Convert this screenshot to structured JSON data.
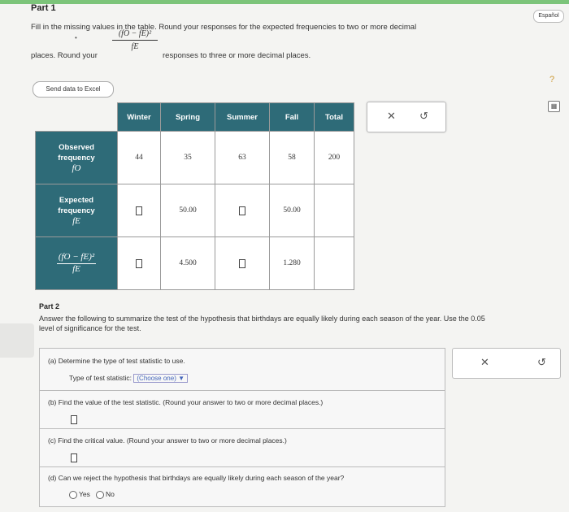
{
  "part1": {
    "heading": "Part 1",
    "instruction_line1": "Fill in the missing values in the table. Round your responses for the expected frequencies to two or more decimal",
    "instruction_line2_a": "places. Round your",
    "instruction_line2_b": "responses to three or more decimal places.",
    "fraction_num": "(fO − fE)²",
    "fraction_den": "fE",
    "excel_button": "Send data to Excel"
  },
  "header": {
    "espanol": "Español",
    "help": "?",
    "calculator": "▦"
  },
  "table": {
    "columns": [
      "Winter",
      "Spring",
      "Summer",
      "Fall",
      "Total"
    ],
    "rows": [
      {
        "label_line1": "Observed",
        "label_line2": "frequency",
        "symbol": "fO",
        "cells": [
          "44",
          "35",
          "63",
          "58",
          "200"
        ]
      },
      {
        "label_line1": "Expected",
        "label_line2": "frequency",
        "symbol": "fE",
        "cells": [
          "",
          "50.00",
          "",
          "50.00",
          ""
        ]
      },
      {
        "label_num": "(fO − fE)²",
        "label_den": "fE",
        "cells": [
          "",
          "4.500",
          "",
          "1.280",
          ""
        ]
      }
    ]
  },
  "widget": {
    "clear": "✕",
    "undo": "↺"
  },
  "part2": {
    "heading": "Part 2",
    "text": "Answer the following to summarize the test of the hypothesis that birthdays are equally likely during each season of the year. Use the 0.05 level of significance for the test.",
    "qa_label": "(a)  Determine the type of test statistic to use.",
    "qa_sub": "Type of test statistic:",
    "qa_select": "(Choose one) ▼",
    "qb_label": "(b)  Find the value of the test statistic. (Round your answer to two or more decimal places.)",
    "qc_label": "(c)  Find the critical value. (Round your answer to two or more decimal places.)",
    "qd_label": "(d)  Can we reject the hypothesis that birthdays are equally likely during each season of the year?",
    "yes": "Yes",
    "no": "No"
  }
}
